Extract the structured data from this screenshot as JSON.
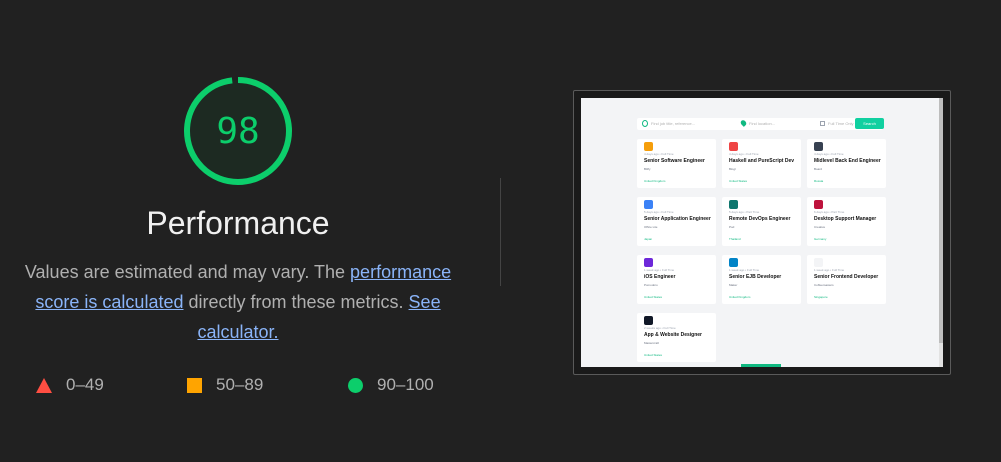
{
  "score": {
    "value": "98",
    "fraction": 0.98,
    "title": "Performance",
    "color": "#0cce6b"
  },
  "description": {
    "text_before": "Values are estimated and may vary. The ",
    "link_score": "performance score is calculated",
    "text_middle": " directly from these metrics. ",
    "link_calculator": "See calculator."
  },
  "legend": [
    {
      "shape": "triangle",
      "range": "0–49",
      "color": "#ff4e42"
    },
    {
      "shape": "square",
      "range": "50–89",
      "color": "#ffa400"
    },
    {
      "shape": "circle",
      "range": "90–100",
      "color": "#0cce6b"
    }
  ],
  "thumbnail": {
    "search": {
      "keyword_placeholder": "Find job title, reference...",
      "location_placeholder": "Find location...",
      "checkbox_label": "Full Time Only",
      "button": "Search"
    },
    "jobs": [
      {
        "meta": "4 days ago  •  Full Time",
        "title": "Senior Software Engineer",
        "company": "Bitfly",
        "location": "United Kingdom",
        "logo_color": "#f59e0b"
      },
      {
        "meta": "4 days ago  •  Full Time",
        "title": "Haskell and PureScript Dev",
        "company": "Blogr",
        "location": "United States",
        "logo_color": "#ef4444"
      },
      {
        "meta": "4 days ago  •  Full Time",
        "title": "Midlevel Back End Engineer",
        "company": "Board",
        "location": "Russia",
        "logo_color": "#374151"
      },
      {
        "meta": "5 days ago  •  Full Time",
        "title": "Senior Application Engineer",
        "company": "Office Lite",
        "location": "Japan",
        "logo_color": "#3b82f6"
      },
      {
        "meta": "5 days ago  •  Part Time",
        "title": "Remote DevOps Engineer",
        "company": "Pod",
        "location": "Thailand",
        "logo_color": "#0f766e"
      },
      {
        "meta": "6 days ago  •  Part Time",
        "title": "Desktop Support Manager",
        "company": "Creative",
        "location": "Germany",
        "logo_color": "#be123c"
      },
      {
        "meta": "1 week ago  •  Full Time",
        "title": "iOS Engineer",
        "company": "Pomodoro",
        "location": "United States",
        "logo_color": "#6d28d9"
      },
      {
        "meta": "1 week ago  •  Full Time",
        "title": "Senior EJB Developer",
        "company": "Maker",
        "location": "United Kingdom",
        "logo_color": "#0284c7"
      },
      {
        "meta": "1 week ago  •  Full Time",
        "title": "Senior Frontend Developer",
        "company": "Coffeeroasters",
        "location": "Singapore",
        "logo_color": "#f3f4f6"
      },
      {
        "meta": "2 weeks ago  •  Full Time",
        "title": "App & Website Designer",
        "company": "Mastercraft",
        "location": "United States",
        "logo_color": "#111827"
      }
    ]
  }
}
